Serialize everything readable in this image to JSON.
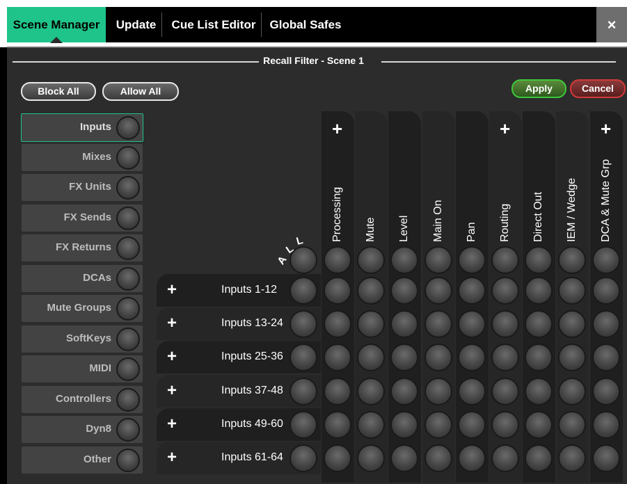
{
  "tabs": [
    {
      "label": "Scene Manager",
      "active": true
    },
    {
      "label": "Update",
      "active": false
    },
    {
      "label": "Cue List Editor",
      "active": false
    },
    {
      "label": "Global Safes",
      "active": false
    }
  ],
  "close_label": "×",
  "filter_title": "Recall Filter - Scene 1",
  "buttons": {
    "block_all": "Block All",
    "allow_all": "Allow All",
    "apply": "Apply",
    "cancel": "Cancel"
  },
  "categories": [
    {
      "label": "Inputs",
      "active": true
    },
    {
      "label": "Mixes",
      "active": false
    },
    {
      "label": "FX Units",
      "active": false
    },
    {
      "label": "FX Sends",
      "active": false
    },
    {
      "label": "FX Returns",
      "active": false
    },
    {
      "label": "DCAs",
      "active": false
    },
    {
      "label": "Mute Groups",
      "active": false
    },
    {
      "label": "SoftKeys",
      "active": false
    },
    {
      "label": "MIDI",
      "active": false
    },
    {
      "label": "Controllers",
      "active": false
    },
    {
      "label": "Dyn8",
      "active": false
    },
    {
      "label": "Other",
      "active": false
    }
  ],
  "all_label": "ALL",
  "columns": [
    {
      "label": "Processing",
      "expandable": true
    },
    {
      "label": "Mute",
      "expandable": false
    },
    {
      "label": "Level",
      "expandable": false
    },
    {
      "label": "Main On",
      "expandable": false
    },
    {
      "label": "Pan",
      "expandable": false
    },
    {
      "label": "Routing",
      "expandable": true
    },
    {
      "label": "Direct Out",
      "expandable": false
    },
    {
      "label": "IEM / Wedge",
      "expandable": false
    },
    {
      "label": "DCA & Mute Grp",
      "expandable": true
    }
  ],
  "rows": [
    {
      "label": "Inputs 1-12"
    },
    {
      "label": "Inputs 13-24"
    },
    {
      "label": "Inputs 25-36"
    },
    {
      "label": "Inputs 37-48"
    },
    {
      "label": "Inputs 49-60"
    },
    {
      "label": "Inputs 61-64"
    }
  ],
  "plus_symbol": "+",
  "colors": {
    "accent": "#1ec48a",
    "apply_border": "#3ec83a",
    "cancel_border": "#d23a3a",
    "panel": "#2c2c2c"
  }
}
